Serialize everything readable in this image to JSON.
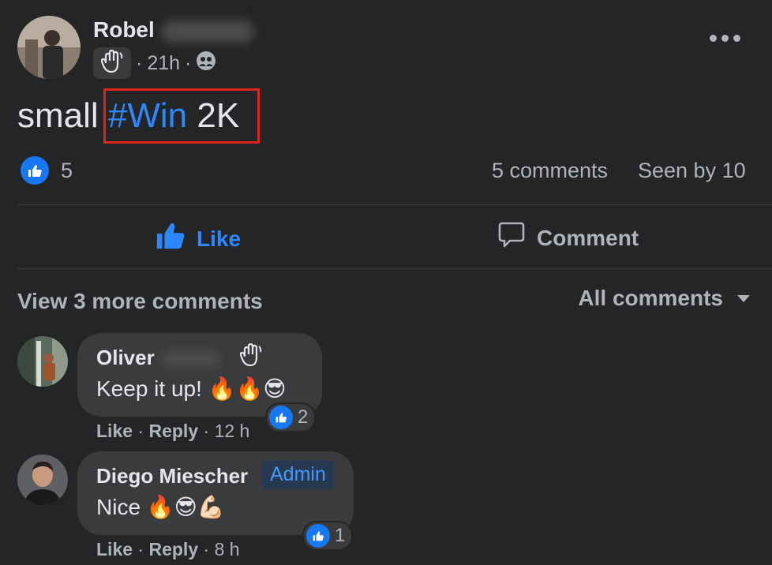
{
  "post": {
    "author_first": "Robel",
    "time": "21h",
    "separator": "·",
    "text_prefix": "small ",
    "hashtag": "#Win",
    "text_suffix": " 2K",
    "like_count": "5",
    "comments_count": "5 comments",
    "seen_by": "Seen by 10"
  },
  "actions": {
    "like": "Like",
    "comment": "Comment"
  },
  "comments_section": {
    "view_more": "View 3 more comments",
    "sort": "All comments"
  },
  "comments": [
    {
      "name": "Oliver",
      "text": "Keep it up! 🔥🔥😎",
      "like": "Like",
      "reply": "Reply",
      "time": "12 h",
      "reactions": "2"
    },
    {
      "name": "Diego Miescher",
      "badge": "Admin",
      "text": "Nice 🔥😎💪🏻",
      "like": "Like",
      "reply": "Reply",
      "time": "8 h",
      "reactions": "1"
    }
  ],
  "colors": {
    "background": "#242526",
    "accent": "#2d88ff",
    "highlight_border": "#e0261c"
  }
}
